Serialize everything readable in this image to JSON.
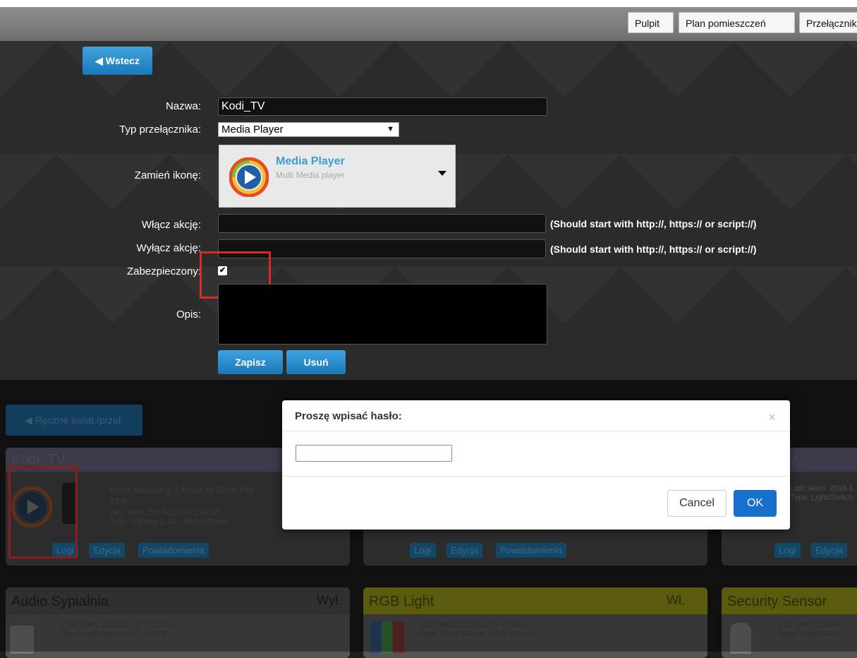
{
  "nav": {
    "pulpit": "Pulpit",
    "plan": "Plan pomieszczeń",
    "przelaczniki": "Przełączniki"
  },
  "form": {
    "back_label": "Wstecz",
    "name_label": "Nazwa:",
    "name_value": "Kodi_TV",
    "type_label": "Typ przełącznika:",
    "type_value": "Media Player",
    "icon_label": "Zamień ikonę:",
    "icon_title": "Media Player",
    "icon_subtitle": "Multi Media player",
    "on_label": "Włącz akcję:",
    "off_label": "Wyłącz akcję:",
    "url_hint": "(Should start with http://, https:// or script://)",
    "protected_label": "Zabezpieczony:",
    "desc_label": "Opis:",
    "save_label": "Zapisz",
    "delete_label": "Usuń"
  },
  "background": {
    "group_label": "Ręczne świat./przeł.",
    "kodi_title": "Kodi_TV",
    "kodi_media": "Most Amazing 1 Hour of Cute Kid",
    "kodi_level": "22%",
    "kodi_lastseen_label": "Last Seen:",
    "kodi_lastseen": "2018-11-20 21:54:35",
    "kodi_type_label": "Type:",
    "kodi_type": "Lighting 2, AC, Media Player",
    "btn_logi": "Logi",
    "btn_edycja": "Edycja",
    "btn_powiadomienia": "Powiadomienia",
    "right_lastseen": "Last Seen: 2018-1",
    "right_type": "Type: Light/Switch",
    "right_title_fragment": "y",
    "audio_title": "Audio Sypialnia",
    "audio_status": "Wył.",
    "audio_lastseen": "Last Seen: 2018-11-20 20:59:06",
    "audio_type": "Type: Light/Switch, AC, On/Off",
    "rgb_title": "RGB Light",
    "rgb_status": "Wł.",
    "rgb_lastseen": "Last Seen: 2018-11-20 17:51:10",
    "rgb_type": "Type: Color Switch, RGB, Dimmer",
    "security_title": "Security Sensor",
    "security_lastseen": "Last Seen: 2018-1",
    "security_type": "Type: Light/Switch"
  },
  "modal": {
    "title": "Proszę wpisać hasło:",
    "close": "×",
    "cancel_label": "Cancel",
    "ok_label": "OK"
  }
}
